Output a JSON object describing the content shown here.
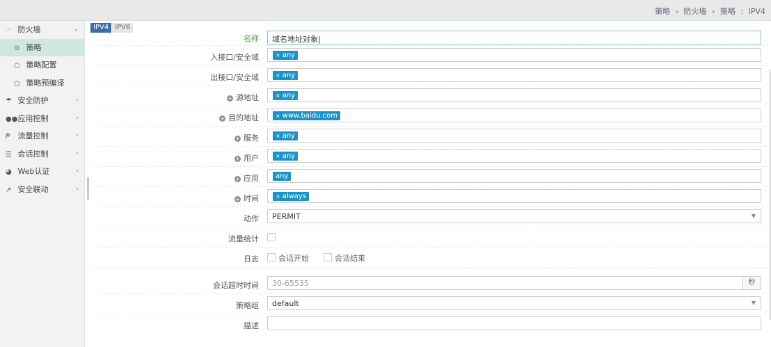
{
  "breadcrumb": {
    "items": [
      "策略",
      "防火墙",
      "策略"
    ],
    "sep1": "›",
    "sep2": "›",
    "sep3": ":",
    "current": "IPV4"
  },
  "sidebar": {
    "firewall": {
      "label": "防火墙",
      "icon": "hand-pointer-icon",
      "arrow": "⌄"
    },
    "subitems": [
      {
        "label": "策略",
        "active": true
      },
      {
        "label": "策略配置",
        "active": false
      },
      {
        "label": "策略预编译",
        "active": false
      }
    ],
    "items": [
      {
        "label": "安全防护",
        "icon": "umbrella-icon",
        "arrow": "‹"
      },
      {
        "label": "应用控制",
        "icon": "glasses-icon",
        "arrow": "‹"
      },
      {
        "label": "流量控制",
        "icon": "flow-icon",
        "arrow": "‹"
      },
      {
        "label": "会话控制",
        "icon": "sliders-icon",
        "arrow": "‹"
      },
      {
        "label": "Web认证",
        "icon": "globe-icon",
        "arrow": "‹"
      },
      {
        "label": "安全联动",
        "icon": "external-link-icon",
        "arrow": "‹"
      }
    ]
  },
  "tabs": [
    {
      "label": "IPV4",
      "active": true
    },
    {
      "label": "IPV6",
      "active": false
    }
  ],
  "form": {
    "name": {
      "label": "名称",
      "value": "域名地址对象|"
    },
    "in_iface": {
      "label": "入接口/安全域",
      "tag": "any"
    },
    "out_iface": {
      "label": "出接口/安全域",
      "tag": "any"
    },
    "src_addr": {
      "label": "源地址",
      "tag": "any"
    },
    "dst_addr": {
      "label": "目的地址",
      "tag": "www.baidu.com"
    },
    "service": {
      "label": "服务",
      "tag": "any"
    },
    "user": {
      "label": "用户",
      "tag": "any"
    },
    "app": {
      "label": "应用",
      "tag": "any"
    },
    "time": {
      "label": "时间",
      "tag": "always"
    },
    "action": {
      "label": "动作",
      "value": "PERMIT"
    },
    "traffic_stat": {
      "label": "流量统计"
    },
    "log": {
      "label": "日志",
      "opt1": "会话开始",
      "opt2": "会话结束"
    },
    "timeout": {
      "label": "会话超时时间",
      "placeholder": "30-65535",
      "unit": "秒"
    },
    "policy_group": {
      "label": "策略组",
      "value": "default"
    },
    "desc": {
      "label": "描述",
      "value": ""
    }
  },
  "glyphs": {
    "x": "×",
    "plus": "+",
    "caret": "▼",
    "radio_on": "⊙",
    "radio_off": "○"
  },
  "colors": {
    "tag": "#1a94c6",
    "active_tab": "#3a6ea5",
    "active_side": "#cfe8de"
  }
}
